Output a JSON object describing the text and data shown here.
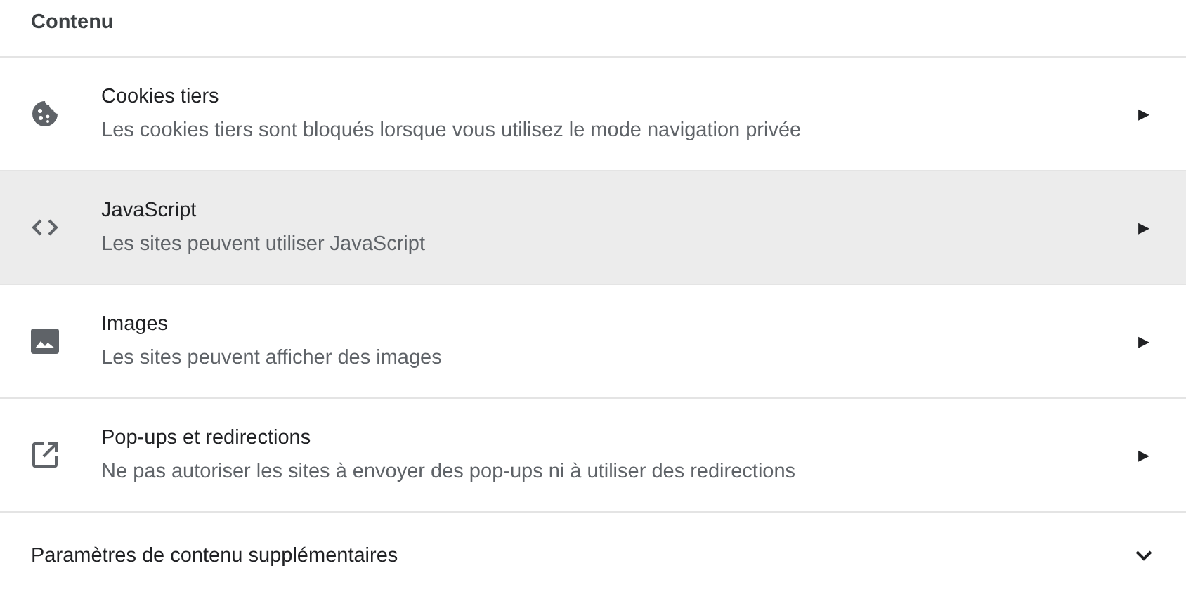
{
  "section_title": "Contenu",
  "items": [
    {
      "kind": "cookies",
      "title": "Cookies tiers",
      "description": "Les cookies tiers sont bloqués lorsque vous utilisez le mode navigation privée",
      "highlighted": false,
      "arrow": "▸"
    },
    {
      "kind": "javascript",
      "title": "JavaScript",
      "description": "Les sites peuvent utiliser JavaScript",
      "highlighted": true,
      "arrow": "▸"
    },
    {
      "kind": "images",
      "title": "Images",
      "description": "Les sites peuvent afficher des images",
      "highlighted": false,
      "arrow": "▸"
    },
    {
      "kind": "popups",
      "title": "Pop-ups et redirections",
      "description": "Ne pas autoriser les sites à envoyer des pop-ups ni à utiliser des redirections",
      "highlighted": false,
      "arrow": "▸"
    }
  ],
  "more": {
    "label": "Paramètres de contenu supplémentaires",
    "expanded": false
  }
}
